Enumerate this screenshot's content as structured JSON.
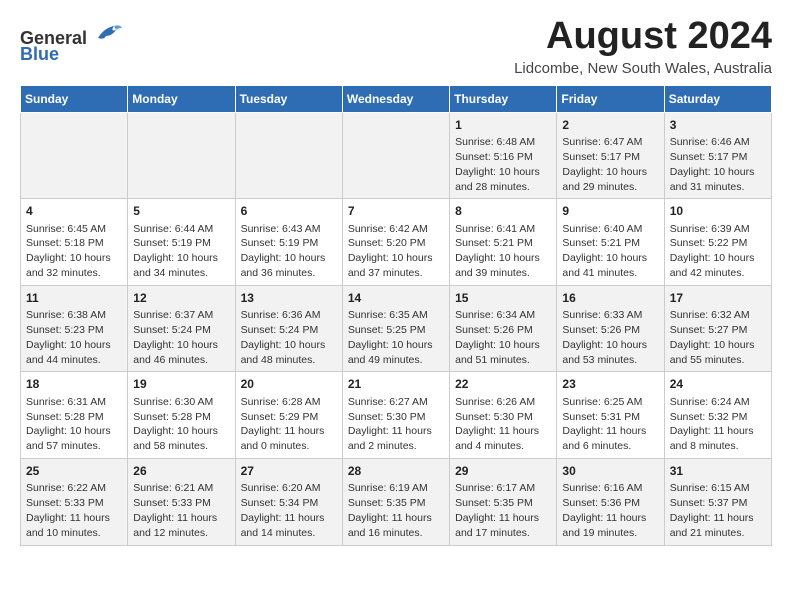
{
  "header": {
    "logo_general": "General",
    "logo_blue": "Blue",
    "month_title": "August 2024",
    "subtitle": "Lidcombe, New South Wales, Australia"
  },
  "days_of_week": [
    "Sunday",
    "Monday",
    "Tuesday",
    "Wednesday",
    "Thursday",
    "Friday",
    "Saturday"
  ],
  "weeks": [
    [
      {
        "day": "",
        "info": ""
      },
      {
        "day": "",
        "info": ""
      },
      {
        "day": "",
        "info": ""
      },
      {
        "day": "",
        "info": ""
      },
      {
        "day": "1",
        "info": "Sunrise: 6:48 AM\nSunset: 5:16 PM\nDaylight: 10 hours\nand 28 minutes."
      },
      {
        "day": "2",
        "info": "Sunrise: 6:47 AM\nSunset: 5:17 PM\nDaylight: 10 hours\nand 29 minutes."
      },
      {
        "day": "3",
        "info": "Sunrise: 6:46 AM\nSunset: 5:17 PM\nDaylight: 10 hours\nand 31 minutes."
      }
    ],
    [
      {
        "day": "4",
        "info": "Sunrise: 6:45 AM\nSunset: 5:18 PM\nDaylight: 10 hours\nand 32 minutes."
      },
      {
        "day": "5",
        "info": "Sunrise: 6:44 AM\nSunset: 5:19 PM\nDaylight: 10 hours\nand 34 minutes."
      },
      {
        "day": "6",
        "info": "Sunrise: 6:43 AM\nSunset: 5:19 PM\nDaylight: 10 hours\nand 36 minutes."
      },
      {
        "day": "7",
        "info": "Sunrise: 6:42 AM\nSunset: 5:20 PM\nDaylight: 10 hours\nand 37 minutes."
      },
      {
        "day": "8",
        "info": "Sunrise: 6:41 AM\nSunset: 5:21 PM\nDaylight: 10 hours\nand 39 minutes."
      },
      {
        "day": "9",
        "info": "Sunrise: 6:40 AM\nSunset: 5:21 PM\nDaylight: 10 hours\nand 41 minutes."
      },
      {
        "day": "10",
        "info": "Sunrise: 6:39 AM\nSunset: 5:22 PM\nDaylight: 10 hours\nand 42 minutes."
      }
    ],
    [
      {
        "day": "11",
        "info": "Sunrise: 6:38 AM\nSunset: 5:23 PM\nDaylight: 10 hours\nand 44 minutes."
      },
      {
        "day": "12",
        "info": "Sunrise: 6:37 AM\nSunset: 5:24 PM\nDaylight: 10 hours\nand 46 minutes."
      },
      {
        "day": "13",
        "info": "Sunrise: 6:36 AM\nSunset: 5:24 PM\nDaylight: 10 hours\nand 48 minutes."
      },
      {
        "day": "14",
        "info": "Sunrise: 6:35 AM\nSunset: 5:25 PM\nDaylight: 10 hours\nand 49 minutes."
      },
      {
        "day": "15",
        "info": "Sunrise: 6:34 AM\nSunset: 5:26 PM\nDaylight: 10 hours\nand 51 minutes."
      },
      {
        "day": "16",
        "info": "Sunrise: 6:33 AM\nSunset: 5:26 PM\nDaylight: 10 hours\nand 53 minutes."
      },
      {
        "day": "17",
        "info": "Sunrise: 6:32 AM\nSunset: 5:27 PM\nDaylight: 10 hours\nand 55 minutes."
      }
    ],
    [
      {
        "day": "18",
        "info": "Sunrise: 6:31 AM\nSunset: 5:28 PM\nDaylight: 10 hours\nand 57 minutes."
      },
      {
        "day": "19",
        "info": "Sunrise: 6:30 AM\nSunset: 5:28 PM\nDaylight: 10 hours\nand 58 minutes."
      },
      {
        "day": "20",
        "info": "Sunrise: 6:28 AM\nSunset: 5:29 PM\nDaylight: 11 hours\nand 0 minutes."
      },
      {
        "day": "21",
        "info": "Sunrise: 6:27 AM\nSunset: 5:30 PM\nDaylight: 11 hours\nand 2 minutes."
      },
      {
        "day": "22",
        "info": "Sunrise: 6:26 AM\nSunset: 5:30 PM\nDaylight: 11 hours\nand 4 minutes."
      },
      {
        "day": "23",
        "info": "Sunrise: 6:25 AM\nSunset: 5:31 PM\nDaylight: 11 hours\nand 6 minutes."
      },
      {
        "day": "24",
        "info": "Sunrise: 6:24 AM\nSunset: 5:32 PM\nDaylight: 11 hours\nand 8 minutes."
      }
    ],
    [
      {
        "day": "25",
        "info": "Sunrise: 6:22 AM\nSunset: 5:33 PM\nDaylight: 11 hours\nand 10 minutes."
      },
      {
        "day": "26",
        "info": "Sunrise: 6:21 AM\nSunset: 5:33 PM\nDaylight: 11 hours\nand 12 minutes."
      },
      {
        "day": "27",
        "info": "Sunrise: 6:20 AM\nSunset: 5:34 PM\nDaylight: 11 hours\nand 14 minutes."
      },
      {
        "day": "28",
        "info": "Sunrise: 6:19 AM\nSunset: 5:35 PM\nDaylight: 11 hours\nand 16 minutes."
      },
      {
        "day": "29",
        "info": "Sunrise: 6:17 AM\nSunset: 5:35 PM\nDaylight: 11 hours\nand 17 minutes."
      },
      {
        "day": "30",
        "info": "Sunrise: 6:16 AM\nSunset: 5:36 PM\nDaylight: 11 hours\nand 19 minutes."
      },
      {
        "day": "31",
        "info": "Sunrise: 6:15 AM\nSunset: 5:37 PM\nDaylight: 11 hours\nand 21 minutes."
      }
    ]
  ]
}
